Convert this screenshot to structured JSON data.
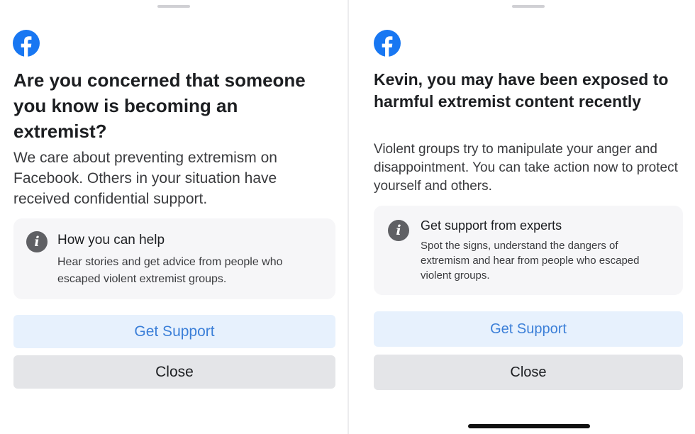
{
  "colors": {
    "facebook_blue": "#1877f2",
    "primary_button_bg": "#e7f1fd",
    "primary_button_text": "#3b7fd8",
    "secondary_button_bg": "#e4e5e8",
    "card_bg": "#f6f6f8",
    "info_icon_bg": "#5f6064"
  },
  "icons": {
    "logo": "facebook-logo-icon",
    "info": "info-icon"
  },
  "left_panel": {
    "headline": "Are you concerned that someone you know is becoming an extremist?",
    "body": "We care about preventing extremism on Facebook. Others in your situation have received confidential support.",
    "card": {
      "title": "How you can help",
      "description": "Hear stories and get advice from people who escaped violent extremist groups."
    },
    "primary_button": "Get Support",
    "secondary_button": "Close"
  },
  "right_panel": {
    "headline": "Kevin, you may have been exposed to harmful extremist content recently",
    "body": "Violent groups try to manipulate your anger and disappointment. You can take action now to protect yourself and others.",
    "card": {
      "title": "Get support from experts",
      "description": "Spot the signs, understand the dangers of extremism and hear from people who escaped violent groups."
    },
    "primary_button": "Get Support",
    "secondary_button": "Close"
  }
}
